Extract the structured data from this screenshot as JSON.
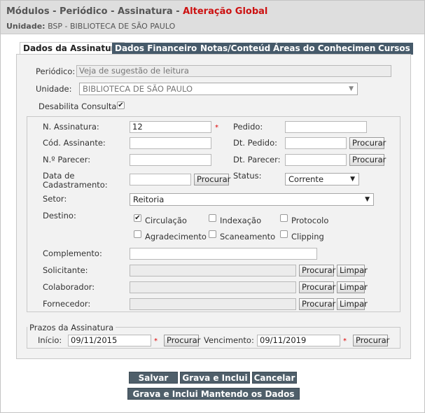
{
  "header": {
    "title_prefix": "Módulos - Periódico - Assinatura - ",
    "title_highlight": "Alteração Global",
    "unit_label": "Unidade:",
    "unit_value": "BSP - BIBLIOTECA DE SÃO PAULO"
  },
  "tabs": [
    "Dados da Assinatura",
    "Dados Financeiros",
    "Notas/Conteúdo",
    "Áreas do Conhecimento",
    "Cursos"
  ],
  "form": {
    "periodico_label": "Periódico:",
    "periodico_value": "Veja de sugestão de leitura",
    "unidade_label": "Unidade:",
    "unidade_value": "BIBLIOTECA DE SÃO PAULO",
    "desabilita_label": "Desabilita Consulta",
    "desabilita_checked": true,
    "n_assinatura_label": "N. Assinatura:",
    "n_assinatura_value": "12",
    "pedido_label": "Pedido:",
    "pedido_value": "",
    "cod_assinante_label": "Cód. Assinante:",
    "cod_assinante_value": "",
    "dt_pedido_label": "Dt. Pedido:",
    "dt_pedido_value": "",
    "n_parecer_label": "N.º Parecer:",
    "n_parecer_value": "",
    "dt_parecer_label": "Dt. Parecer:",
    "dt_parecer_value": "",
    "data_cadastro_label_1": "Data de",
    "data_cadastro_label_2": "Cadastramento:",
    "data_cadastro_value": "",
    "status_label": "Status:",
    "status_value": "Corrente",
    "setor_label": "Setor:",
    "setor_value": "Reitoria",
    "destino_label": "Destino:",
    "destino_options": [
      {
        "label": "Circulação",
        "checked": true
      },
      {
        "label": "Indexação",
        "checked": false
      },
      {
        "label": "Protocolo",
        "checked": false
      },
      {
        "label": "Agradecimento",
        "checked": false
      },
      {
        "label": "Scaneamento",
        "checked": false
      },
      {
        "label": "Clipping",
        "checked": false
      }
    ],
    "complemento_label": "Complemento:",
    "complemento_value": "",
    "solicitante_label": "Solicitante:",
    "colaborador_label": "Colaborador:",
    "fornecedor_label": "Fornecedor:",
    "procurar_label": "Procurar",
    "limpar_label": "Limpar",
    "required_mark": "*"
  },
  "prazos": {
    "legend": "Prazos da Assinatura",
    "inicio_label": "Início:",
    "inicio_value": "09/11/2015",
    "vencimento_label": "Vencimento:",
    "vencimento_value": "09/11/2019"
  },
  "actions": {
    "salvar": "Salvar",
    "grava_inclui": "Grava e Inclui",
    "cancelar": "Cancelar",
    "grava_inclui_mantendo": "Grava e Inclui Mantendo os Dados"
  },
  "colors": {
    "title_highlight": "#cc1111",
    "tab_inactive": "#465a6a",
    "action_button": "#4f5f6a",
    "required": "#dd0000"
  }
}
